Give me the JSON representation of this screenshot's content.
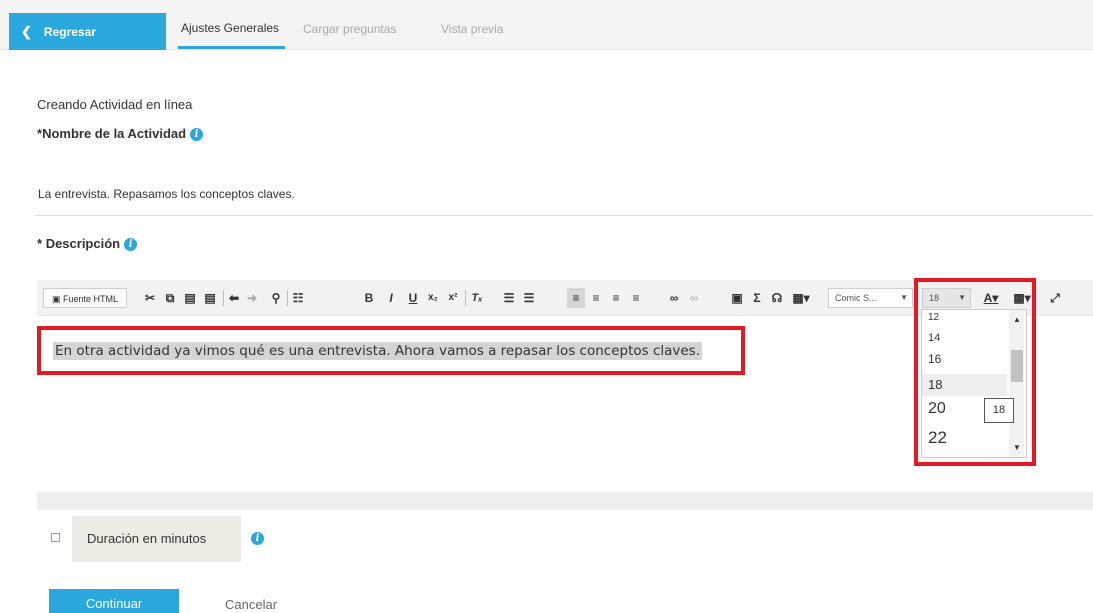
{
  "header": {
    "back_label": "Regresar",
    "tabs": [
      {
        "label": "Ajustes Generales"
      },
      {
        "label": "Cargar preguntas"
      },
      {
        "label": "Vista previa"
      }
    ]
  },
  "form": {
    "context_label": "Creando Actividad en línea",
    "name_label": "Nombre de la Actividad",
    "name_value": "La entrevista. Repasamos los conceptos claves.",
    "description_label": "Descripción",
    "required_mark": "*"
  },
  "toolbar": {
    "source_label": "Fuente HTML",
    "font_combo": "Comic S...",
    "size_combo": "18"
  },
  "editor": {
    "content": "En otra actividad ya vimos qué es una entrevista. Ahora vamos a repasar los conceptos claves."
  },
  "size_dropdown": {
    "options": [
      "12",
      "14",
      "16",
      "18",
      "20",
      "22"
    ],
    "selected": "18",
    "tooltip": "18"
  },
  "duration": {
    "label": "Duración en minutos"
  },
  "actions": {
    "continue_label": "Continuar",
    "cancel_label": "Cancelar"
  },
  "colors": {
    "accent": "#2aa7dc",
    "highlight": "#e01b24"
  }
}
